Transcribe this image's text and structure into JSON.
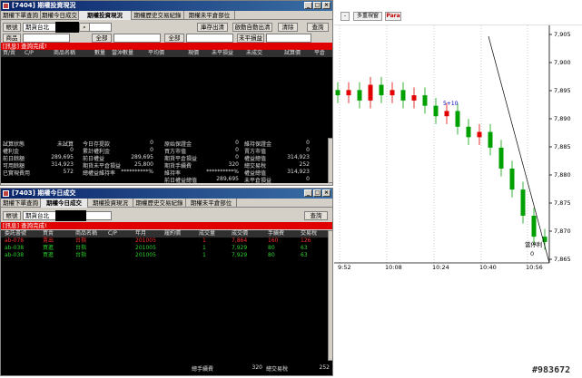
{
  "chart": {
    "toolbar_buttons": [
      "-",
      "多重視窗",
      "Para"
    ],
    "price_ticks": [
      "7,905",
      "7,900",
      "7,895",
      "7,890",
      "7,885",
      "7,880",
      "7,875",
      "7,870",
      "7,865"
    ],
    "time_ticks": [
      "9:52",
      "10:08",
      "10:24",
      "10:40",
      "10:56"
    ],
    "annotation_top": "5+10",
    "annotation_bottom": "當停利",
    "annotation_zero": "0",
    "watermark": "#983672",
    "colors": {
      "up": "#e00000",
      "down": "#00a000",
      "trendline": "#000000"
    }
  },
  "chart_data": {
    "type": "candlestick",
    "x": [
      "9:44",
      "9:48",
      "9:52",
      "9:56",
      "10:00",
      "10:04",
      "10:08",
      "10:12",
      "10:16",
      "10:20",
      "10:24",
      "10:28",
      "10:32",
      "10:36",
      "10:40",
      "10:44",
      "10:48",
      "10:52",
      "10:56",
      "11:00"
    ],
    "close": [
      7894,
      7895,
      7893,
      7896,
      7894,
      7895,
      7893,
      7894,
      7892,
      7890,
      7891,
      7888,
      7886,
      7887,
      7884,
      7880,
      7876,
      7871,
      7867,
      7866
    ],
    "ylim": [
      7862,
      7907
    ]
  },
  "w1": {
    "title": "[7404] 期權投資現況",
    "tabs": [
      "期權下單查詢",
      "期權今日成交",
      "期權投資現況",
      "期權歷史交易紀錄",
      "期權未平倉部位"
    ],
    "selected_tab_index": 2,
    "buttons": {
      "close_pos": "庫存出清",
      "auto_close": "啟動自動出清",
      "clear": "清除",
      "query": "查詢"
    },
    "account_value": "期貨台北",
    "filters": [
      "商品",
      "全部",
      "全部",
      "未平損益"
    ],
    "status": "[訊息] 查詢完成!",
    "columns": [
      "買/賣",
      "C/P",
      "商品名稱",
      "數量",
      "當沖數量",
      "平均價",
      "現價",
      "未平損益",
      "未成交",
      "試算價",
      "平倉"
    ],
    "summary": [
      [
        "試算狀態",
        "未試算",
        "今日存提款",
        "0",
        "原始保證金",
        "0",
        "維持保證金",
        "0"
      ],
      [
        "權利金",
        "0",
        "累計權利金",
        "0",
        "買方市值",
        "0",
        "賣方市值",
        "0"
      ],
      [
        "前日餘額",
        "289,695",
        "前日權益",
        "289,695",
        "期貨平倉損益",
        "0",
        "權益總值",
        "314,923"
      ],
      [
        "可用餘額",
        "314,923",
        "期貨未平倉損益",
        "25,800",
        "期貨手續費",
        "320",
        "總交易稅",
        "252"
      ],
      [
        "已實現費用",
        "572",
        "總權益維持率",
        "**********%",
        "維持率",
        "**********%",
        "權益總值",
        "314,923"
      ],
      [
        "",
        "",
        "",
        "",
        "前日權益總值",
        "289,695",
        "未平倉損益",
        "0"
      ]
    ]
  },
  "w2": {
    "title": "[7403] 期權今日成交",
    "tabs": [
      "期權下單查詢",
      "期權今日成交",
      "期權投資現況",
      "期權歷史交易紀錄",
      "期權未平倉部位"
    ],
    "selected_tab_index": 1,
    "account_label": "帳號",
    "account_value": "期貨台北",
    "query": "查詢",
    "status": "[訊息] 查詢完成!",
    "columns": [
      "委託書號",
      "買賣",
      "商品名稱",
      "C/P",
      "年月",
      "履約價",
      "成交量",
      "成交價",
      "手續費",
      "交易稅"
    ],
    "rows": [
      {
        "id": "ab-078",
        "side": "賣出",
        "name": "台指",
        "cp": "",
        "ym": "201005",
        "strike": "",
        "qty": "1",
        "price": "7,864",
        "fee": "160",
        "tax": "126",
        "color": "#ff3030"
      },
      {
        "id": "ab-038",
        "side": "買進",
        "name": "台指",
        "cp": "",
        "ym": "201005",
        "strike": "",
        "qty": "1",
        "price": "7,929",
        "fee": "80",
        "tax": "63",
        "color": "#30d030"
      },
      {
        "id": "ab-038",
        "side": "買進",
        "name": "台指",
        "cp": "",
        "ym": "201005",
        "strike": "",
        "qty": "1",
        "price": "7,929",
        "fee": "80",
        "tax": "63",
        "color": "#30d030"
      }
    ],
    "footer": {
      "fee_label": "總手續費",
      "fee_value": "320",
      "tax_label": "總交易稅",
      "tax_value": "252"
    }
  }
}
